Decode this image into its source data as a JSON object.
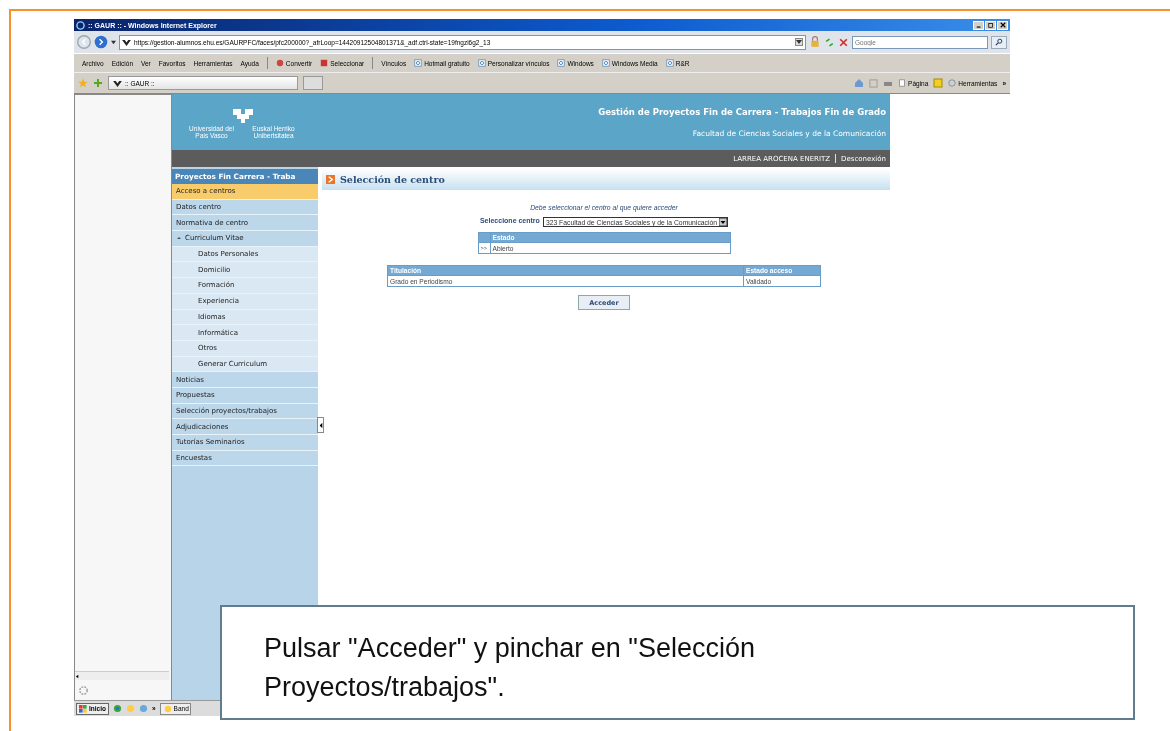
{
  "browser": {
    "title": ":: GAUR :: - Windows Internet Explorer",
    "address": "https://gestion-alumnos.ehu.es/GAURPFC/faces/pfc200000?_afrLoop=14420912504801371&_adf.ctrl-state=19fngzi6g2_13",
    "search_placeholder": "Google",
    "menu": [
      "Archivo",
      "Edición",
      "Ver",
      "Favoritos",
      "Herramientas",
      "Ayuda"
    ],
    "toolbar": [
      "Convertir",
      "Seleccionar"
    ],
    "links_label": "Vínculos",
    "links": [
      "Hotmail gratuito",
      "Personalizar vínculos",
      "Windows",
      "Windows Media",
      "R&R"
    ],
    "tab": ":: GAUR ::",
    "command_bar": [
      "Página",
      "Herramientas"
    ],
    "chevron": "»"
  },
  "site": {
    "logo_text_1": "Universidad del País Vasco",
    "logo_text_2": "Euskal Herriko Unibertsitatea",
    "title": "Gestión de Proyectos Fin de Carrera - Trabajos Fin de Grado",
    "faculty": "Facultad de Ciencias Sociales y de la Comunicación",
    "user": "LARREA AROCENA ENERITZ",
    "logout": "Desconexión"
  },
  "sidebar": {
    "title": "Proyectos Fin Carrera - Traba",
    "items": [
      {
        "label": "Acceso a centros",
        "selected": true
      },
      {
        "label": "Datos centro",
        "selected": false
      },
      {
        "label": "Normativa de centro",
        "selected": false
      },
      {
        "label": "Curriculum Vitae",
        "selected": false,
        "expanded": true,
        "children": [
          {
            "label": "Datos Personales",
            "selected": false
          },
          {
            "label": "Domicilio",
            "selected": false
          },
          {
            "label": "Formación",
            "selected": false
          },
          {
            "label": "Experiencia",
            "selected": false
          },
          {
            "label": "Idiomas",
            "selected": false
          },
          {
            "label": "Informática",
            "selected": false
          },
          {
            "label": "Otros",
            "selected": false
          },
          {
            "label": "Generar Curriculum",
            "selected": false
          }
        ]
      },
      {
        "label": "Noticias",
        "selected": false
      },
      {
        "label": "Propuestas",
        "selected": false
      },
      {
        "label": "Selección proyectos/trabajos",
        "selected": false
      },
      {
        "label": "Adjudicaciones",
        "selected": false
      },
      {
        "label": "Tutorías Seminarios",
        "selected": false
      },
      {
        "label": "Encuestas",
        "selected": false
      }
    ]
  },
  "main": {
    "heading": "Selección de centro",
    "hint": "Debe seleccionar el centro al que quiere acceder",
    "select_label": "Seleccione centro",
    "select_value": "323 Facultad de Ciencias Sociales y de la Comunicación",
    "estado_table": {
      "columns": [
        "Estado"
      ],
      "rows": [
        {
          "marker": ">>",
          "cells": [
            "Abierto"
          ]
        }
      ]
    },
    "titulacion_table": {
      "columns": [
        "Titulación",
        "Estado acceso"
      ],
      "rows": [
        [
          "Grado en Periodismo",
          "Validado"
        ]
      ]
    },
    "button": "Acceder"
  },
  "taskbar": {
    "start": "Inicio",
    "chevron": "»",
    "task": "Band"
  },
  "callout": "Pulsar \"Acceder\" y pinchar en \"Selección Proyectos/trabajos\"."
}
